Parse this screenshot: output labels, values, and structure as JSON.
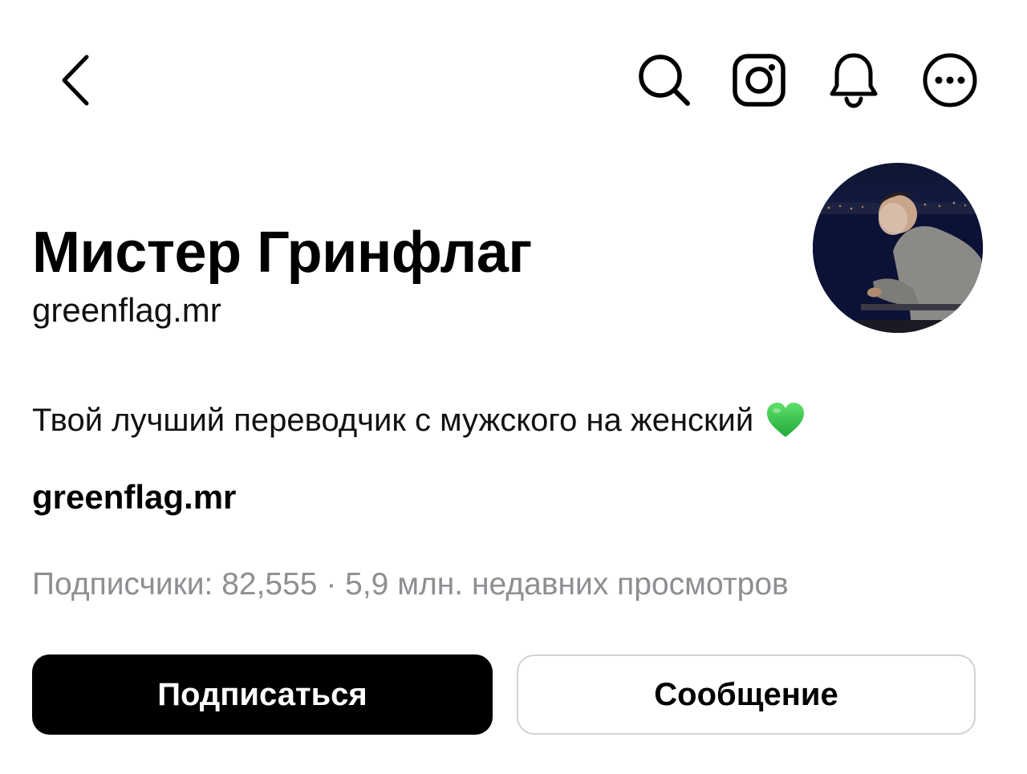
{
  "header": {
    "icons": [
      "back-icon",
      "search-icon",
      "instagram-icon",
      "bell-icon",
      "more-icon"
    ]
  },
  "profile": {
    "display_name": "Мистер Гринфлаг",
    "username": "greenflag.mr",
    "bio": "Твой лучший переводчик с мужского на женский",
    "bio_emoji": "green-heart-icon",
    "link": "greenflag.mr",
    "stats": "Подписчики: 82,555 · 5,9 млн. недавних просмотров"
  },
  "actions": {
    "follow_label": "Подписаться",
    "message_label": "Сообщение"
  },
  "colors": {
    "primary_button_bg": "#000000",
    "secondary_text": "#8e8e93",
    "heart": "#34c759"
  }
}
